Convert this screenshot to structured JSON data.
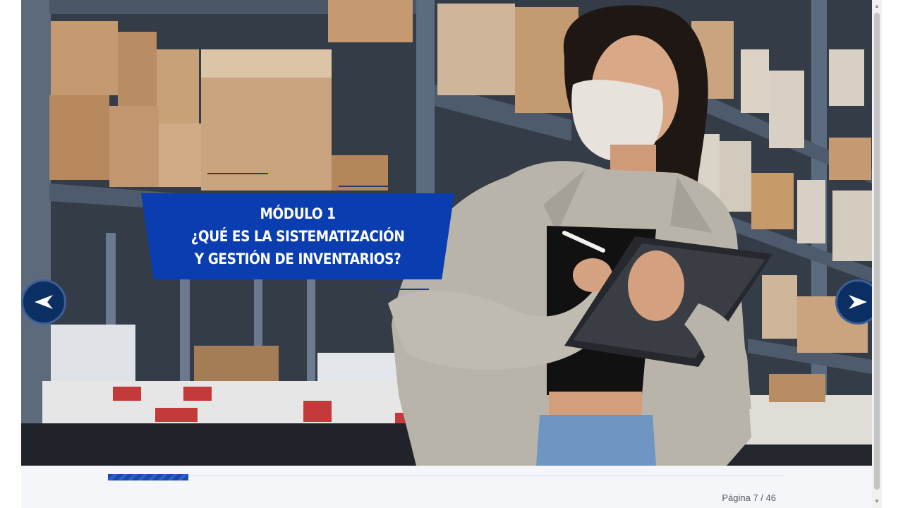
{
  "slide": {
    "title_lines": [
      "MÓDULO 1",
      "¿QUÉ ES LA SISTEMATIZACIÓN",
      "Y GESTIÓN DE INVENTARIOS?"
    ],
    "image_description": "woman-with-mask-using-tablet-in-warehouse"
  },
  "navigation": {
    "prev_icon": "chevron-left-icon",
    "next_icon": "chevron-right-icon"
  },
  "footer": {
    "page_label": "Página 7 / 46",
    "current_page": 7,
    "total_pages": 46,
    "progress_fraction": 0.119
  },
  "colors": {
    "banner": "#0a3db0",
    "nav_button": "#0c2f63",
    "progress": "#1c47b8"
  }
}
